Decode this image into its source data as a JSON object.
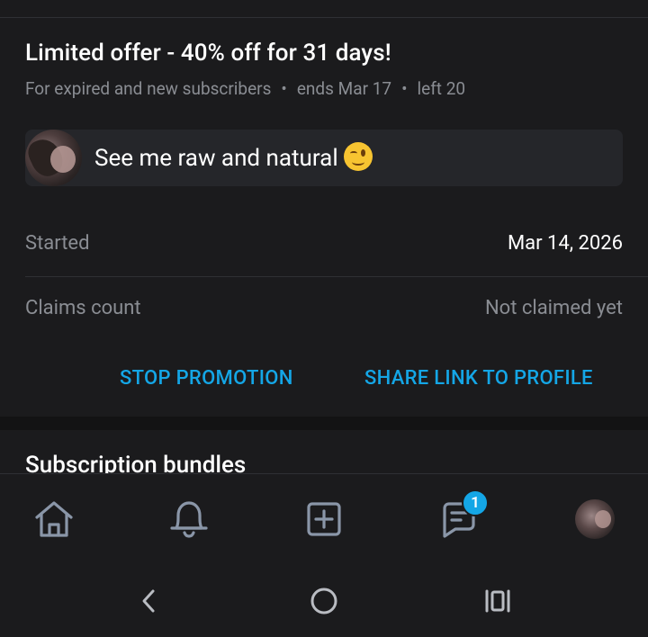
{
  "promo": {
    "title": "Limited offer - 40% off for 31 days!",
    "audience": "For expired and new subscribers",
    "ends": "ends Mar 17",
    "left": "left 20",
    "message": "See me raw and natural"
  },
  "details": {
    "started_label": "Started",
    "started_value": "Mar 14, 2026",
    "claims_label": "Claims count",
    "claims_value": "Not claimed yet"
  },
  "actions": {
    "stop_label": "STOP PROMOTION",
    "share_label": "SHARE LINK TO PROFILE"
  },
  "section": {
    "bundles_title": "Subscription bundles"
  },
  "tabbar": {
    "messages_badge": "1",
    "icons": [
      "home-icon",
      "bell-icon",
      "add-post-icon",
      "messages-icon",
      "profile-avatar"
    ]
  },
  "colors": {
    "background": "#1b1b1d",
    "accent": "#14a6e6",
    "muted_text": "#8a8d93",
    "card": "#25262a"
  }
}
